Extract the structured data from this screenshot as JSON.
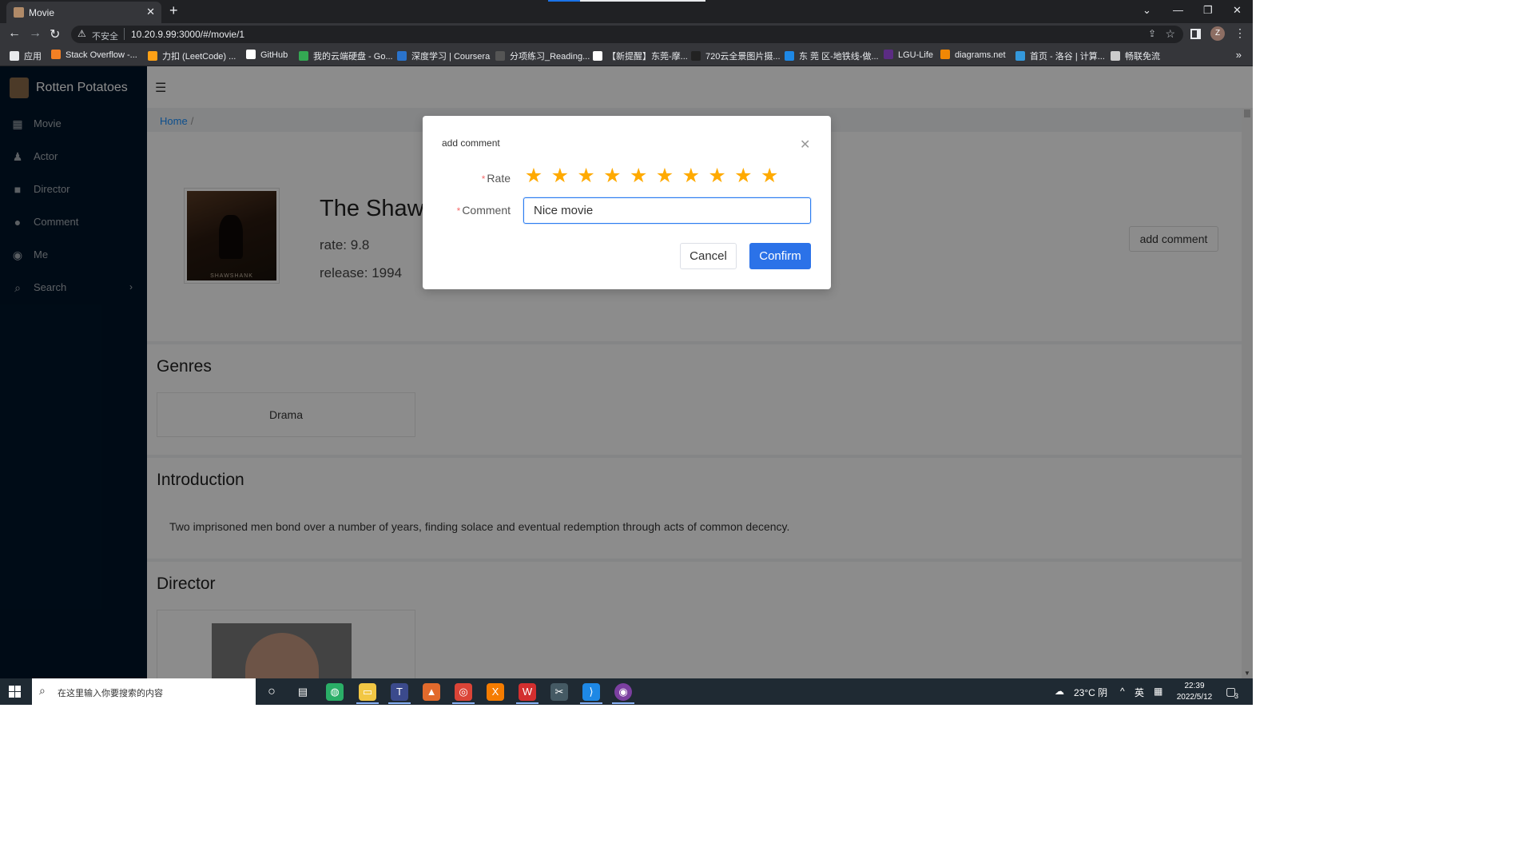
{
  "browser": {
    "tab_title": "Movie",
    "omnibox_insecure": "不安全",
    "url": "10.20.9.99:3000/#/movie/1",
    "bookmarks": [
      {
        "label": "应用",
        "color": "#e8eaed"
      },
      {
        "label": "Stack Overflow -...",
        "color": "#f48024"
      },
      {
        "label": "力扣 (LeetCode) ...",
        "color": "#ffa116"
      },
      {
        "label": "GitHub",
        "color": "#ffffff"
      },
      {
        "label": "我的云端硬盘 - Go...",
        "color": "#34a853"
      },
      {
        "label": "深度学习 | Coursera",
        "color": "#2a73cc"
      },
      {
        "label": "分项练习_Reading...",
        "color": "#555555"
      },
      {
        "label": "【新提醒】东莞-摩...",
        "color": "#ffffff"
      },
      {
        "label": "720云全景图片摄...",
        "color": "#222222"
      },
      {
        "label": "东 莞 区-地铁线-做...",
        "color": "#1e88e5"
      },
      {
        "label": "LGU-Life",
        "color": "#5b2c83"
      },
      {
        "label": "diagrams.net",
        "color": "#f08705"
      },
      {
        "label": "首页 - 洛谷 | 计算...",
        "color": "#3498db"
      },
      {
        "label": "畅联免流",
        "color": "#cccccc"
      }
    ]
  },
  "sidebar": {
    "logo_text": "Rotten Potatoes",
    "items": [
      {
        "label": "Movie",
        "icon": "film-icon"
      },
      {
        "label": "Actor",
        "icon": "person-icon"
      },
      {
        "label": "Director",
        "icon": "video-camera-icon"
      },
      {
        "label": "Comment",
        "icon": "chat-icon"
      },
      {
        "label": "Me",
        "icon": "user-circle-icon"
      },
      {
        "label": "Search",
        "icon": "search-icon"
      }
    ]
  },
  "breadcrumb": {
    "home": "Home",
    "separator": "/"
  },
  "movie": {
    "title": "The Shawshank Redemption",
    "rate": "rate: 9.8",
    "release": "release: 1994",
    "poster_text": "SHAWSHANK",
    "add_comment_label": "add comment"
  },
  "sections": {
    "genres_title": "Genres",
    "genres": [
      "Drama"
    ],
    "intro_title": "Introduction",
    "intro_text": "Two imprisoned men bond over a number of years, finding solace and eventual redemption through acts of common decency.",
    "director_title": "Director"
  },
  "modal": {
    "title": "add comment",
    "rate_label": "Rate",
    "comment_label": "Comment",
    "rating_value": 10,
    "rating_max": 10,
    "comment_value": "Nice movie",
    "cancel_label": "Cancel",
    "confirm_label": "Confirm",
    "accent_color": "#2b72e8",
    "star_color": "#ffaa00"
  },
  "taskbar": {
    "search_placeholder": "在这里输入你要搜索的内容",
    "weather": "23°C 阴",
    "ime": "英",
    "time": "22:39",
    "date": "2022/5/12",
    "notifications": "3"
  }
}
